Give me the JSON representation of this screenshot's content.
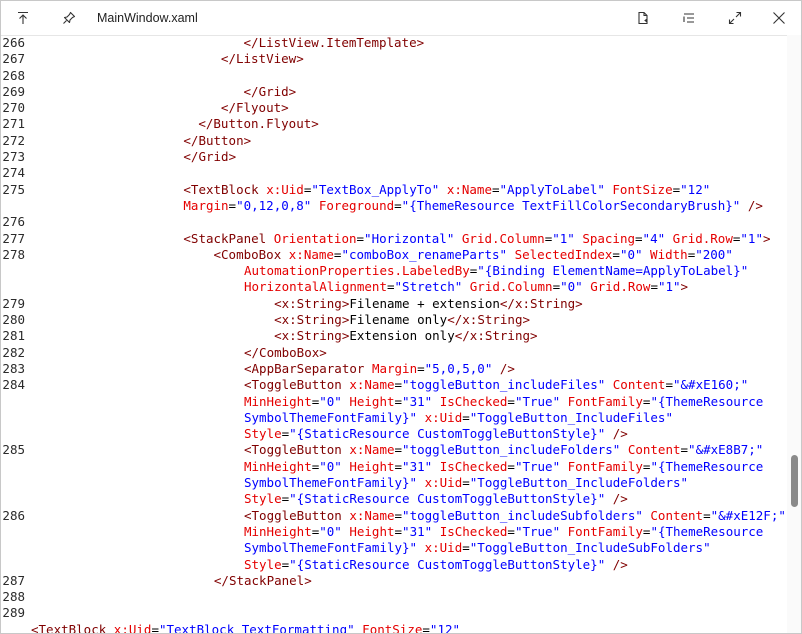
{
  "window": {
    "title": "MainWindow.xaml"
  },
  "icons": {
    "pin_to_top": "arrow-to-top-icon",
    "pin": "pin-icon",
    "document": "document-icon",
    "list": "list-icon",
    "expand": "expand-icon",
    "close": "close-icon"
  },
  "editor": {
    "lines": [
      {
        "n": "266",
        "t": [
          [
            "         ",
            "x"
          ],
          [
            "</",
            "t"
          ],
          [
            "ListView.ItemTemplate",
            "t"
          ],
          [
            ">",
            "t"
          ]
        ]
      },
      {
        "n": "267",
        "t": [
          [
            "      ",
            "x"
          ],
          [
            "</",
            "t"
          ],
          [
            "ListView",
            "t"
          ],
          [
            ">",
            "t"
          ]
        ]
      },
      {
        "n": "268",
        "t": []
      },
      {
        "n": "269",
        "t": [
          [
            "         ",
            "x"
          ],
          [
            "</",
            "t"
          ],
          [
            "Grid",
            "t"
          ],
          [
            ">",
            "t"
          ]
        ]
      },
      {
        "n": "270",
        "t": [
          [
            "      ",
            "x"
          ],
          [
            "</",
            "t"
          ],
          [
            "Flyout",
            "t"
          ],
          [
            ">",
            "t"
          ]
        ]
      },
      {
        "n": "271",
        "t": [
          [
            "   ",
            "x"
          ],
          [
            "</",
            "t"
          ],
          [
            "Button.Flyout",
            "t"
          ],
          [
            ">",
            "t"
          ]
        ]
      },
      {
        "n": "272",
        "t": [
          [
            "</",
            "t"
          ],
          [
            "Button",
            "t"
          ],
          [
            ">",
            "t"
          ]
        ]
      },
      {
        "n": "273",
        "t": [
          [
            "</",
            "t"
          ],
          [
            "Grid",
            "t"
          ],
          [
            ">",
            "t"
          ]
        ]
      },
      {
        "n": "274",
        "t": []
      },
      {
        "n": "275",
        "t": [
          [
            "<",
            "t"
          ],
          [
            "TextBlock ",
            "t"
          ],
          [
            "x:Uid",
            "a"
          ],
          [
            "=",
            "x"
          ],
          [
            "\"TextBox_ApplyTo\"",
            "v"
          ],
          [
            " ",
            "x"
          ],
          [
            "x:Name",
            "a"
          ],
          [
            "=",
            "x"
          ],
          [
            "\"ApplyToLabel\"",
            "v"
          ],
          [
            " ",
            "x"
          ],
          [
            "FontSize",
            "a"
          ],
          [
            "=",
            "x"
          ],
          [
            "\"12\"",
            "v"
          ]
        ]
      },
      {
        "n": "",
        "t": [
          [
            "Margin",
            "a"
          ],
          [
            "=",
            "x"
          ],
          [
            "\"0,12,0,8\"",
            "v"
          ],
          [
            " ",
            "x"
          ],
          [
            "Foreground",
            "a"
          ],
          [
            "=",
            "x"
          ],
          [
            "\"{ThemeResource TextFillColorSecondaryBrush}\"",
            "v"
          ],
          [
            " />",
            "t"
          ]
        ]
      },
      {
        "n": "276",
        "t": []
      },
      {
        "n": "277",
        "t": [
          [
            "<",
            "t"
          ],
          [
            "StackPanel ",
            "t"
          ],
          [
            "Orientation",
            "a"
          ],
          [
            "=",
            "x"
          ],
          [
            "\"Horizontal\"",
            "v"
          ],
          [
            " ",
            "x"
          ],
          [
            "Grid.Column",
            "a"
          ],
          [
            "=",
            "x"
          ],
          [
            "\"1\"",
            "v"
          ],
          [
            " ",
            "x"
          ],
          [
            "Spacing",
            "a"
          ],
          [
            "=",
            "x"
          ],
          [
            "\"4\"",
            "v"
          ],
          [
            " ",
            "x"
          ],
          [
            "Grid.Row",
            "a"
          ],
          [
            "=",
            "x"
          ],
          [
            "\"1\"",
            "v"
          ],
          [
            ">",
            "t"
          ]
        ]
      },
      {
        "n": "278",
        "t": [
          [
            "    ",
            "x"
          ],
          [
            "<",
            "t"
          ],
          [
            "ComboBox ",
            "t"
          ],
          [
            "x:Name",
            "a"
          ],
          [
            "=",
            "x"
          ],
          [
            "\"comboBox_renameParts\"",
            "v"
          ],
          [
            " ",
            "x"
          ],
          [
            "SelectedIndex",
            "a"
          ],
          [
            "=",
            "x"
          ],
          [
            "\"0\"",
            "v"
          ],
          [
            " ",
            "x"
          ],
          [
            "Width",
            "a"
          ],
          [
            "=",
            "x"
          ],
          [
            "\"200\"",
            "v"
          ]
        ]
      },
      {
        "n": "",
        "t": [
          [
            "    ",
            "x"
          ],
          [
            "AutomationProperties.LabeledBy",
            "a"
          ],
          [
            "=",
            "x"
          ],
          [
            "\"{Binding ElementName=ApplyToLabel}\"",
            "v"
          ]
        ]
      },
      {
        "n": "",
        "t": [
          [
            "    ",
            "x"
          ],
          [
            "HorizontalAlignment",
            "a"
          ],
          [
            "=",
            "x"
          ],
          [
            "\"Stretch\"",
            "v"
          ],
          [
            " ",
            "x"
          ],
          [
            "Grid.Column",
            "a"
          ],
          [
            "=",
            "x"
          ],
          [
            "\"0\"",
            "v"
          ],
          [
            " ",
            "x"
          ],
          [
            "Grid.Row",
            "a"
          ],
          [
            "=",
            "x"
          ],
          [
            "\"1\"",
            "v"
          ],
          [
            ">",
            "t"
          ]
        ]
      },
      {
        "n": "279",
        "t": [
          [
            "        ",
            "x"
          ],
          [
            "<",
            "t"
          ],
          [
            "x:String",
            "t"
          ],
          [
            ">",
            "t"
          ],
          [
            "Filename + extension",
            "x"
          ],
          [
            "</",
            "t"
          ],
          [
            "x:String",
            "t"
          ],
          [
            ">",
            "t"
          ]
        ]
      },
      {
        "n": "280",
        "t": [
          [
            "        ",
            "x"
          ],
          [
            "<",
            "t"
          ],
          [
            "x:String",
            "t"
          ],
          [
            ">",
            "t"
          ],
          [
            "Filename only",
            "x"
          ],
          [
            "</",
            "t"
          ],
          [
            "x:String",
            "t"
          ],
          [
            ">",
            "t"
          ]
        ]
      },
      {
        "n": "281",
        "t": [
          [
            "        ",
            "x"
          ],
          [
            "<",
            "t"
          ],
          [
            "x:String",
            "t"
          ],
          [
            ">",
            "t"
          ],
          [
            "Extension only",
            "x"
          ],
          [
            "</",
            "t"
          ],
          [
            "x:String",
            "t"
          ],
          [
            ">",
            "t"
          ]
        ]
      },
      {
        "n": "282",
        "t": [
          [
            "    ",
            "x"
          ],
          [
            "</",
            "t"
          ],
          [
            "ComboBox",
            "t"
          ],
          [
            ">",
            "t"
          ]
        ]
      },
      {
        "n": "283",
        "t": [
          [
            "    ",
            "x"
          ],
          [
            "<",
            "t"
          ],
          [
            "AppBarSeparator ",
            "t"
          ],
          [
            "Margin",
            "a"
          ],
          [
            "=",
            "x"
          ],
          [
            "\"5,0,5,0\"",
            "v"
          ],
          [
            " />",
            "t"
          ]
        ]
      },
      {
        "n": "284",
        "t": [
          [
            "    ",
            "x"
          ],
          [
            "<",
            "t"
          ],
          [
            "ToggleButton ",
            "t"
          ],
          [
            "x:Name",
            "a"
          ],
          [
            "=",
            "x"
          ],
          [
            "\"toggleButton_includeFiles\"",
            "v"
          ],
          [
            " ",
            "x"
          ],
          [
            "Content",
            "a"
          ],
          [
            "=",
            "x"
          ],
          [
            "\"&#xE160;\"",
            "v"
          ]
        ]
      },
      {
        "n": "",
        "t": [
          [
            "    ",
            "x"
          ],
          [
            "MinHeight",
            "a"
          ],
          [
            "=",
            "x"
          ],
          [
            "\"0\"",
            "v"
          ],
          [
            " ",
            "x"
          ],
          [
            "Height",
            "a"
          ],
          [
            "=",
            "x"
          ],
          [
            "\"31\"",
            "v"
          ],
          [
            " ",
            "x"
          ],
          [
            "IsChecked",
            "a"
          ],
          [
            "=",
            "x"
          ],
          [
            "\"True\"",
            "v"
          ],
          [
            " ",
            "x"
          ],
          [
            "FontFamily",
            "a"
          ],
          [
            "=",
            "x"
          ],
          [
            "\"{ThemeResource",
            "v"
          ]
        ]
      },
      {
        "n": "",
        "t": [
          [
            "    ",
            "x"
          ],
          [
            "SymbolThemeFontFamily}\"",
            "v"
          ],
          [
            " ",
            "x"
          ],
          [
            "x:Uid",
            "a"
          ],
          [
            "=",
            "x"
          ],
          [
            "\"ToggleButton_IncludeFiles\"",
            "v"
          ]
        ]
      },
      {
        "n": "",
        "t": [
          [
            "    ",
            "x"
          ],
          [
            "Style",
            "a"
          ],
          [
            "=",
            "x"
          ],
          [
            "\"{StaticResource CustomToggleButtonStyle}\"",
            "v"
          ],
          [
            " />",
            "t"
          ]
        ]
      },
      {
        "n": "285",
        "t": [
          [
            "    ",
            "x"
          ],
          [
            "<",
            "t"
          ],
          [
            "ToggleButton ",
            "t"
          ],
          [
            "x:Name",
            "a"
          ],
          [
            "=",
            "x"
          ],
          [
            "\"toggleButton_includeFolders\"",
            "v"
          ],
          [
            " ",
            "x"
          ],
          [
            "Content",
            "a"
          ],
          [
            "=",
            "x"
          ],
          [
            "\"&#xE8B7;\"",
            "v"
          ]
        ]
      },
      {
        "n": "",
        "t": [
          [
            "    ",
            "x"
          ],
          [
            "MinHeight",
            "a"
          ],
          [
            "=",
            "x"
          ],
          [
            "\"0\"",
            "v"
          ],
          [
            " ",
            "x"
          ],
          [
            "Height",
            "a"
          ],
          [
            "=",
            "x"
          ],
          [
            "\"31\"",
            "v"
          ],
          [
            " ",
            "x"
          ],
          [
            "IsChecked",
            "a"
          ],
          [
            "=",
            "x"
          ],
          [
            "\"True\"",
            "v"
          ],
          [
            " ",
            "x"
          ],
          [
            "FontFamily",
            "a"
          ],
          [
            "=",
            "x"
          ],
          [
            "\"{ThemeResource",
            "v"
          ]
        ]
      },
      {
        "n": "",
        "t": [
          [
            "    ",
            "x"
          ],
          [
            "SymbolThemeFontFamily}\"",
            "v"
          ],
          [
            " ",
            "x"
          ],
          [
            "x:Uid",
            "a"
          ],
          [
            "=",
            "x"
          ],
          [
            "\"ToggleButton_IncludeFolders\"",
            "v"
          ]
        ]
      },
      {
        "n": "",
        "t": [
          [
            "    ",
            "x"
          ],
          [
            "Style",
            "a"
          ],
          [
            "=",
            "x"
          ],
          [
            "\"{StaticResource CustomToggleButtonStyle}\"",
            "v"
          ],
          [
            " />",
            "t"
          ]
        ]
      },
      {
        "n": "286",
        "t": [
          [
            "    ",
            "x"
          ],
          [
            "<",
            "t"
          ],
          [
            "ToggleButton ",
            "t"
          ],
          [
            "x:Name",
            "a"
          ],
          [
            "=",
            "x"
          ],
          [
            "\"toggleButton_includeSubfolders\"",
            "v"
          ],
          [
            " ",
            "x"
          ],
          [
            "Content",
            "a"
          ],
          [
            "=",
            "x"
          ],
          [
            "\"&#xE12F;\"",
            "v"
          ]
        ]
      },
      {
        "n": "",
        "t": [
          [
            "    ",
            "x"
          ],
          [
            "MinHeight",
            "a"
          ],
          [
            "=",
            "x"
          ],
          [
            "\"0\"",
            "v"
          ],
          [
            " ",
            "x"
          ],
          [
            "Height",
            "a"
          ],
          [
            "=",
            "x"
          ],
          [
            "\"31\"",
            "v"
          ],
          [
            " ",
            "x"
          ],
          [
            "IsChecked",
            "a"
          ],
          [
            "=",
            "x"
          ],
          [
            "\"True\"",
            "v"
          ],
          [
            " ",
            "x"
          ],
          [
            "FontFamily",
            "a"
          ],
          [
            "=",
            "x"
          ],
          [
            "\"{ThemeResource",
            "v"
          ]
        ]
      },
      {
        "n": "",
        "t": [
          [
            "    ",
            "x"
          ],
          [
            "SymbolThemeFontFamily}\"",
            "v"
          ],
          [
            " ",
            "x"
          ],
          [
            "x:Uid",
            "a"
          ],
          [
            "=",
            "x"
          ],
          [
            "\"ToggleButton_IncludeSubFolders\"",
            "v"
          ]
        ]
      },
      {
        "n": "",
        "t": [
          [
            "    ",
            "x"
          ],
          [
            "Style",
            "a"
          ],
          [
            "=",
            "x"
          ],
          [
            "\"{StaticResource CustomToggleButtonStyle}\"",
            "v"
          ],
          [
            " />",
            "t"
          ]
        ]
      },
      {
        "n": "287",
        "t": [
          [
            "</",
            "t"
          ],
          [
            "StackPanel",
            "t"
          ],
          [
            ">",
            "t"
          ]
        ]
      },
      {
        "n": "288",
        "t": []
      },
      {
        "n": "289",
        "t": []
      },
      {
        "n": "",
        "t": [
          [
            "<",
            "t"
          ],
          [
            "TextBlock ",
            "t"
          ],
          [
            "x:Uid",
            "a"
          ],
          [
            "=",
            "x"
          ],
          [
            "\"TextBlock_TextFormatting\"",
            "v"
          ],
          [
            " ",
            "x"
          ],
          [
            "FontSize",
            "a"
          ],
          [
            "=",
            "x"
          ],
          [
            "\"12\"",
            "v"
          ]
        ]
      }
    ]
  }
}
